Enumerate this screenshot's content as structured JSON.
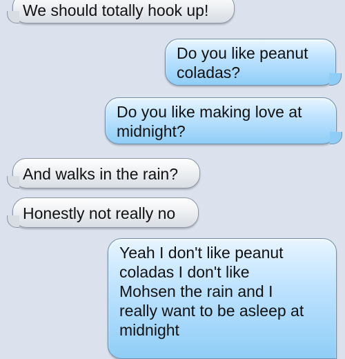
{
  "conversation": {
    "messages": [
      {
        "sender": "incoming",
        "text": "We should totally hook up!"
      },
      {
        "sender": "outgoing",
        "text": "Do you like peanut\ncoladas?"
      },
      {
        "sender": "outgoing",
        "text": "Do you like making love at\nmidnight?"
      },
      {
        "sender": "incoming",
        "text": "And walks in the rain?"
      },
      {
        "sender": "incoming",
        "text": "Honestly not really no"
      },
      {
        "sender": "outgoing",
        "text": "Yeah I don't like peanut\ncoladas I don't like\nMohsen the rain and I\nreally want to be asleep at\nmidnight"
      }
    ]
  },
  "colors": {
    "background": "#dbe2ed",
    "incoming_bubble": "#eef0f3",
    "outgoing_bubble": "#8fcdf6"
  }
}
